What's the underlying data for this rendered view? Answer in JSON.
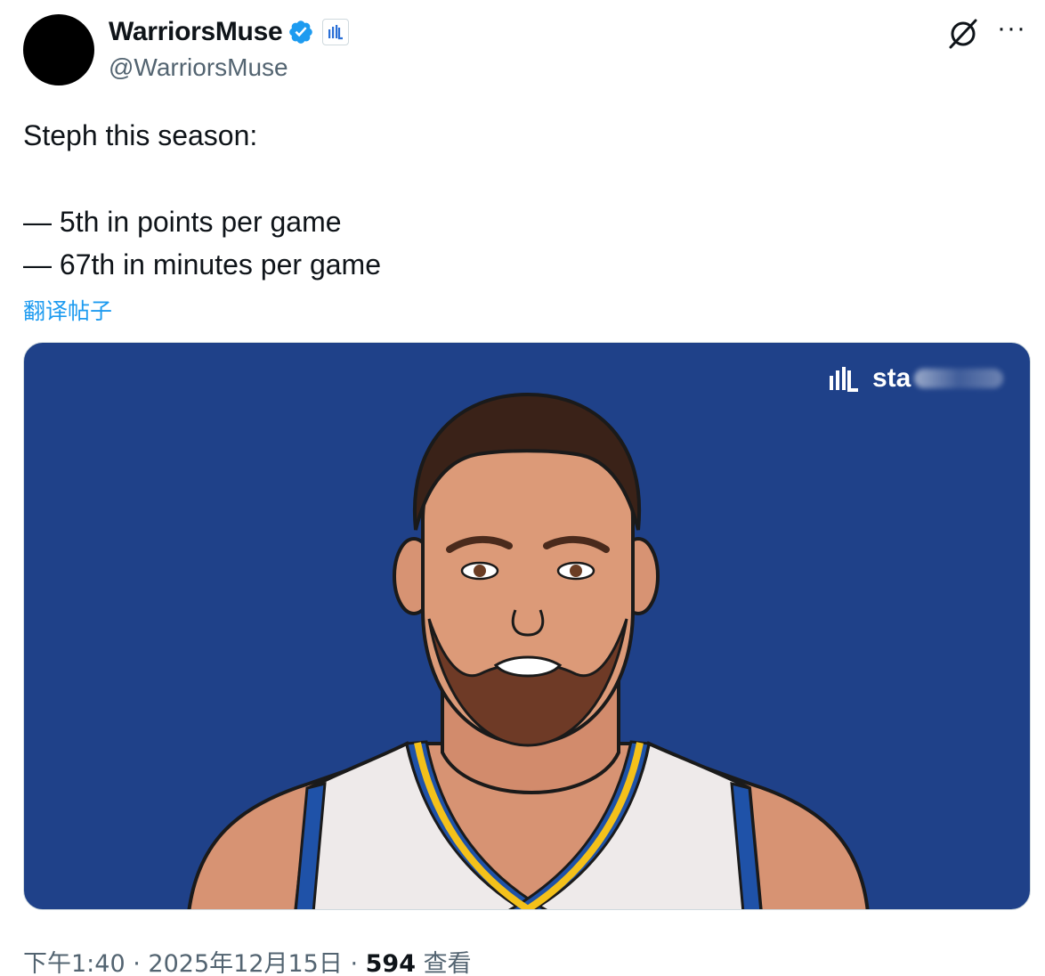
{
  "author": {
    "display_name": "WarriorsMuse",
    "handle": "@WarriorsMuse",
    "verified": true,
    "verified_color": "#1d9bf0"
  },
  "tweet": {
    "lines": [
      "Steph this season:",
      "— 5th in points per game",
      "— 67th in minutes per game"
    ],
    "translate_label": "翻译帖子"
  },
  "media": {
    "background_color": "#1f4189",
    "watermark_text": "sta"
  },
  "meta": {
    "time": "下午1:40",
    "separator": "·",
    "date": "2025年12月15日",
    "views_count": "594",
    "views_label": "查看"
  },
  "icons": {
    "grok": "grok-icon",
    "more": "more-icon",
    "verified": "verified-badge-icon",
    "affiliate": "statmuse-badge-icon"
  }
}
